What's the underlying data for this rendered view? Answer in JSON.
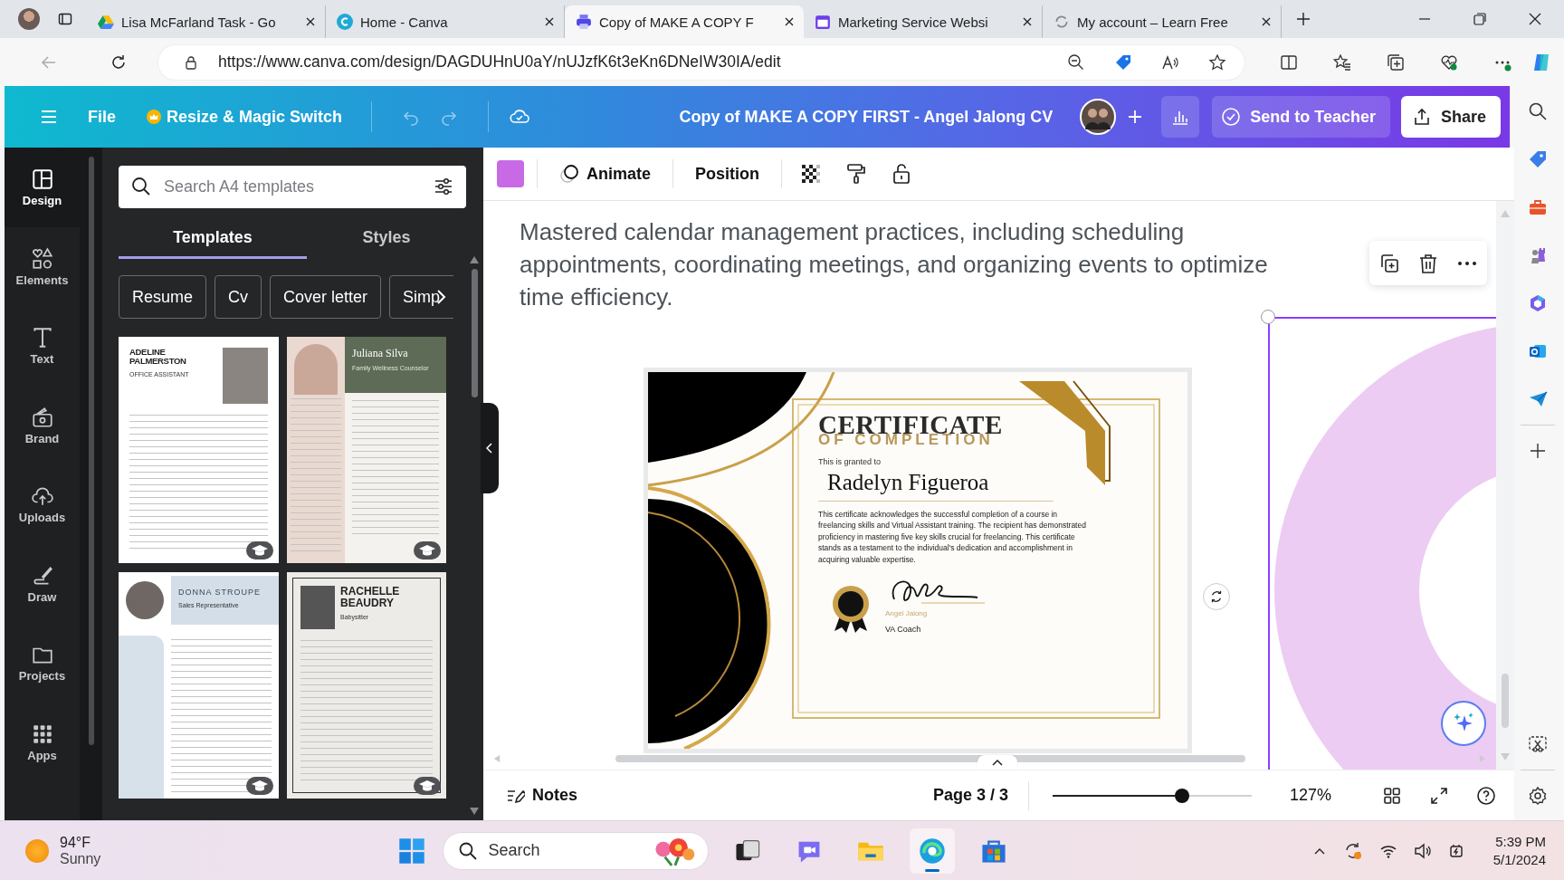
{
  "browser": {
    "tabs": [
      {
        "title": "Lisa McFarland Task - Go",
        "selected": false
      },
      {
        "title": "Home - Canva",
        "selected": false
      },
      {
        "title": "Copy of MAKE A COPY F",
        "selected": true
      },
      {
        "title": "Marketing Service Websi",
        "selected": false
      },
      {
        "title": "My account – Learn Free",
        "selected": false
      }
    ],
    "url": "https://www.canva.com/design/DAGDUHnU0aY/nUJzfK6t3eKn6DNeIW30IA/edit"
  },
  "header": {
    "file": "File",
    "resize": "Resize & Magic Switch",
    "doc_title": "Copy of MAKE A COPY FIRST - Angel Jalong CV",
    "send": "Send to Teacher",
    "share": "Share"
  },
  "rail": [
    {
      "label": "Design",
      "selected": true
    },
    {
      "label": "Elements",
      "selected": false
    },
    {
      "label": "Text",
      "selected": false
    },
    {
      "label": "Brand",
      "selected": false
    },
    {
      "label": "Uploads",
      "selected": false
    },
    {
      "label": "Draw",
      "selected": false
    },
    {
      "label": "Projects",
      "selected": false
    },
    {
      "label": "Apps",
      "selected": false
    }
  ],
  "panel": {
    "search": {
      "placeholder": "Search A4 templates"
    },
    "tabs": [
      {
        "label": "Templates",
        "selected": true
      },
      {
        "label": "Styles",
        "selected": false
      }
    ],
    "chips": [
      "Resume",
      "Cv",
      "Cover letter",
      "Simp"
    ],
    "templates": [
      {
        "kind": "photo-right",
        "name": "ADELINE PALMERSTON",
        "role": "OFFICE ASSISTANT"
      },
      {
        "kind": "green-header",
        "name": "Juliana Silva",
        "role": "Family Wellness Counselor"
      },
      {
        "kind": "blue-header",
        "name": "DONNA STROUPE",
        "role": "Sales Representative"
      },
      {
        "kind": "framed",
        "name": "RACHELLE BEAUDRY",
        "role": "Babysitter"
      }
    ]
  },
  "toolbar": {
    "animate": "Animate",
    "position": "Position"
  },
  "canvas": {
    "paragraph": "Mastered calendar management practices, including scheduling appointments, coordinating meetings, and organizing events to optimize time efficiency.",
    "certificate": {
      "title": "CERTIFICATE",
      "subtitle": "OF COMPLETION",
      "granted": "This is granted to",
      "recipient": "Radelyn Figueroa",
      "body": "This certificate acknowledges the successful completion of a course in freelancing skills and Virtual Assistant training. The recipient has demonstrated proficiency in mastering five key skills crucial for freelancing. This certificate stands as a testament to the individual's dedication and accomplishment in acquiring valuable expertise.",
      "signer": "Angel Jalong",
      "signer_role": "VA Coach"
    }
  },
  "footer": {
    "notes": "Notes",
    "page": "Page 3 / 3",
    "zoom_slider": {
      "level": 0.65
    },
    "zoom": "127%"
  },
  "taskbar": {
    "temperature": "94°F",
    "condition": "Sunny",
    "search": "Search",
    "pinned": [
      {
        "active": false
      },
      {
        "active": false
      },
      {
        "active": false
      },
      {
        "active": true
      },
      {
        "active": false
      }
    ],
    "time": "5:39 PM",
    "date": "5/1/2024"
  }
}
